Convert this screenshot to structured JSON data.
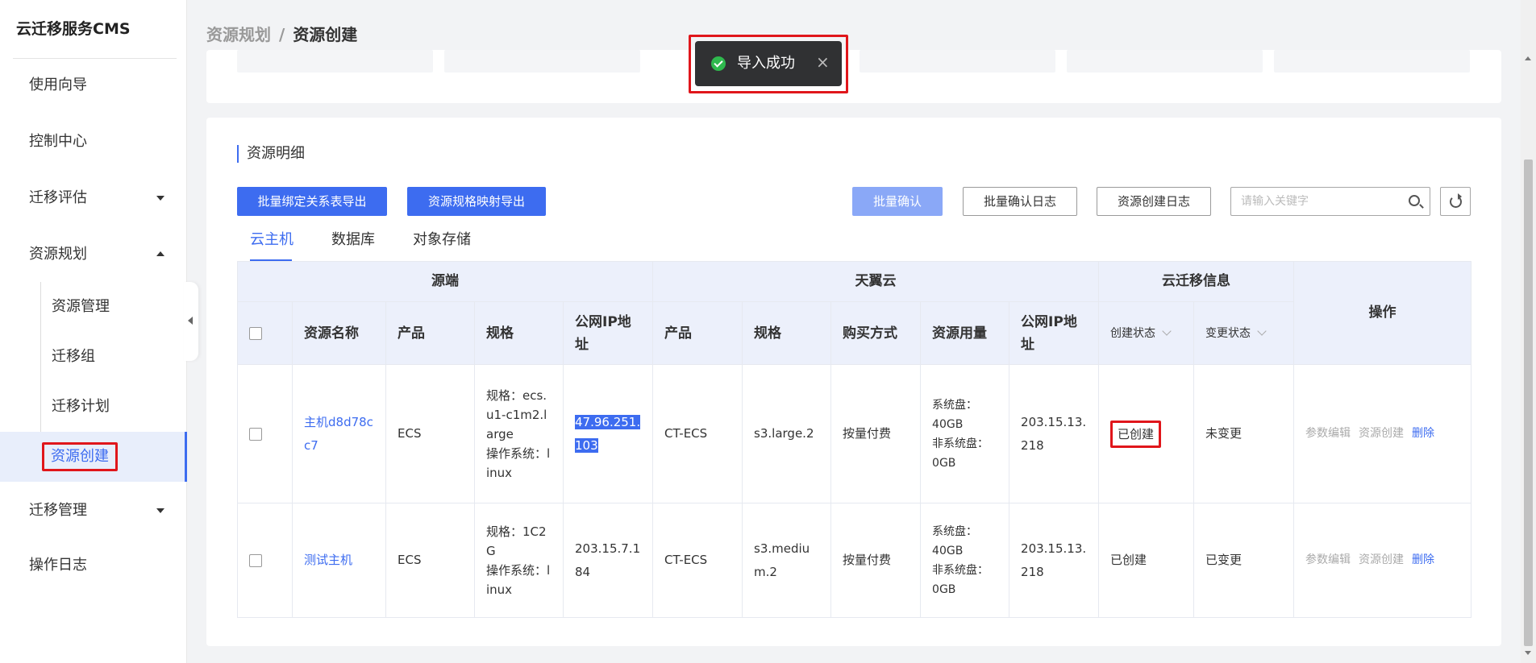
{
  "app": {
    "title": "云迁移服务CMS"
  },
  "sidebar": {
    "items": [
      {
        "label": "使用向导"
      },
      {
        "label": "控制中心"
      },
      {
        "label": "迁移评估"
      },
      {
        "label": "资源规划"
      },
      {
        "label": "迁移管理"
      },
      {
        "label": "操作日志"
      }
    ],
    "sub_items": [
      {
        "label": "资源管理"
      },
      {
        "label": "迁移组"
      },
      {
        "label": "迁移计划"
      },
      {
        "label": "资源创建"
      }
    ]
  },
  "breadcrumb": {
    "parent": "资源规划",
    "separator": "/",
    "current": "资源创建"
  },
  "toast": {
    "message": "导入成功",
    "close": "×"
  },
  "section": {
    "title": "资源明细"
  },
  "toolbar": {
    "export_binding": "批量绑定关系表导出",
    "export_mapping": "资源规格映射导出",
    "batch_confirm": "批量确认",
    "batch_confirm_log": "批量确认日志",
    "creation_log": "资源创建日志"
  },
  "search": {
    "placeholder": "请输入关键字"
  },
  "tabs": [
    {
      "label": "云主机"
    },
    {
      "label": "数据库"
    },
    {
      "label": "对象存储"
    }
  ],
  "table": {
    "groups": {
      "source": "源端",
      "tianyi": "天翼云",
      "migration": "云迁移信息",
      "actions": "操作"
    },
    "columns": {
      "name": "资源名称",
      "product": "产品",
      "spec": "规格",
      "public_ip": "公网IP地址",
      "target_product": "产品",
      "target_spec": "规格",
      "purchase": "购买方式",
      "usage": "资源用量",
      "target_ip": "公网IP地址",
      "create_status": "创建状态",
      "change_status": "变更状态"
    },
    "rows": [
      {
        "name": "主机d8d78cc7",
        "product": "ECS",
        "spec": "规格：ecs.u1-c1m2.large",
        "os": "操作系统：linux",
        "public_ip": "47.96.251.103",
        "target_product": "CT-ECS",
        "target_spec": "s3.large.2",
        "purchase": "按量付费",
        "sys_disk": "系统盘：40GB",
        "data_disk": "非系统盘：0GB",
        "target_ip": "203.15.13.218",
        "create_status": "已创建",
        "change_status": "未变更",
        "op_edit": "参数编辑",
        "op_create": "资源创建",
        "op_delete": "删除"
      },
      {
        "name": "测试主机",
        "product": "ECS",
        "spec": "规格：1C2G",
        "os": "操作系统：linux",
        "public_ip": "203.15.7.184",
        "target_product": "CT-ECS",
        "target_spec": "s3.medium.2",
        "purchase": "按量付费",
        "sys_disk": "系统盘：40GB",
        "data_disk": "非系统盘：0GB",
        "target_ip": "203.15.13.218",
        "create_status": "已创建",
        "change_status": "已变更",
        "op_edit": "参数编辑",
        "op_create": "资源创建",
        "op_delete": "删除"
      }
    ]
  },
  "colors": {
    "accent": "#3d6cf0",
    "highlight_box": "#e0161b",
    "toast_bg": "#303133",
    "success": "#2fb94e"
  }
}
